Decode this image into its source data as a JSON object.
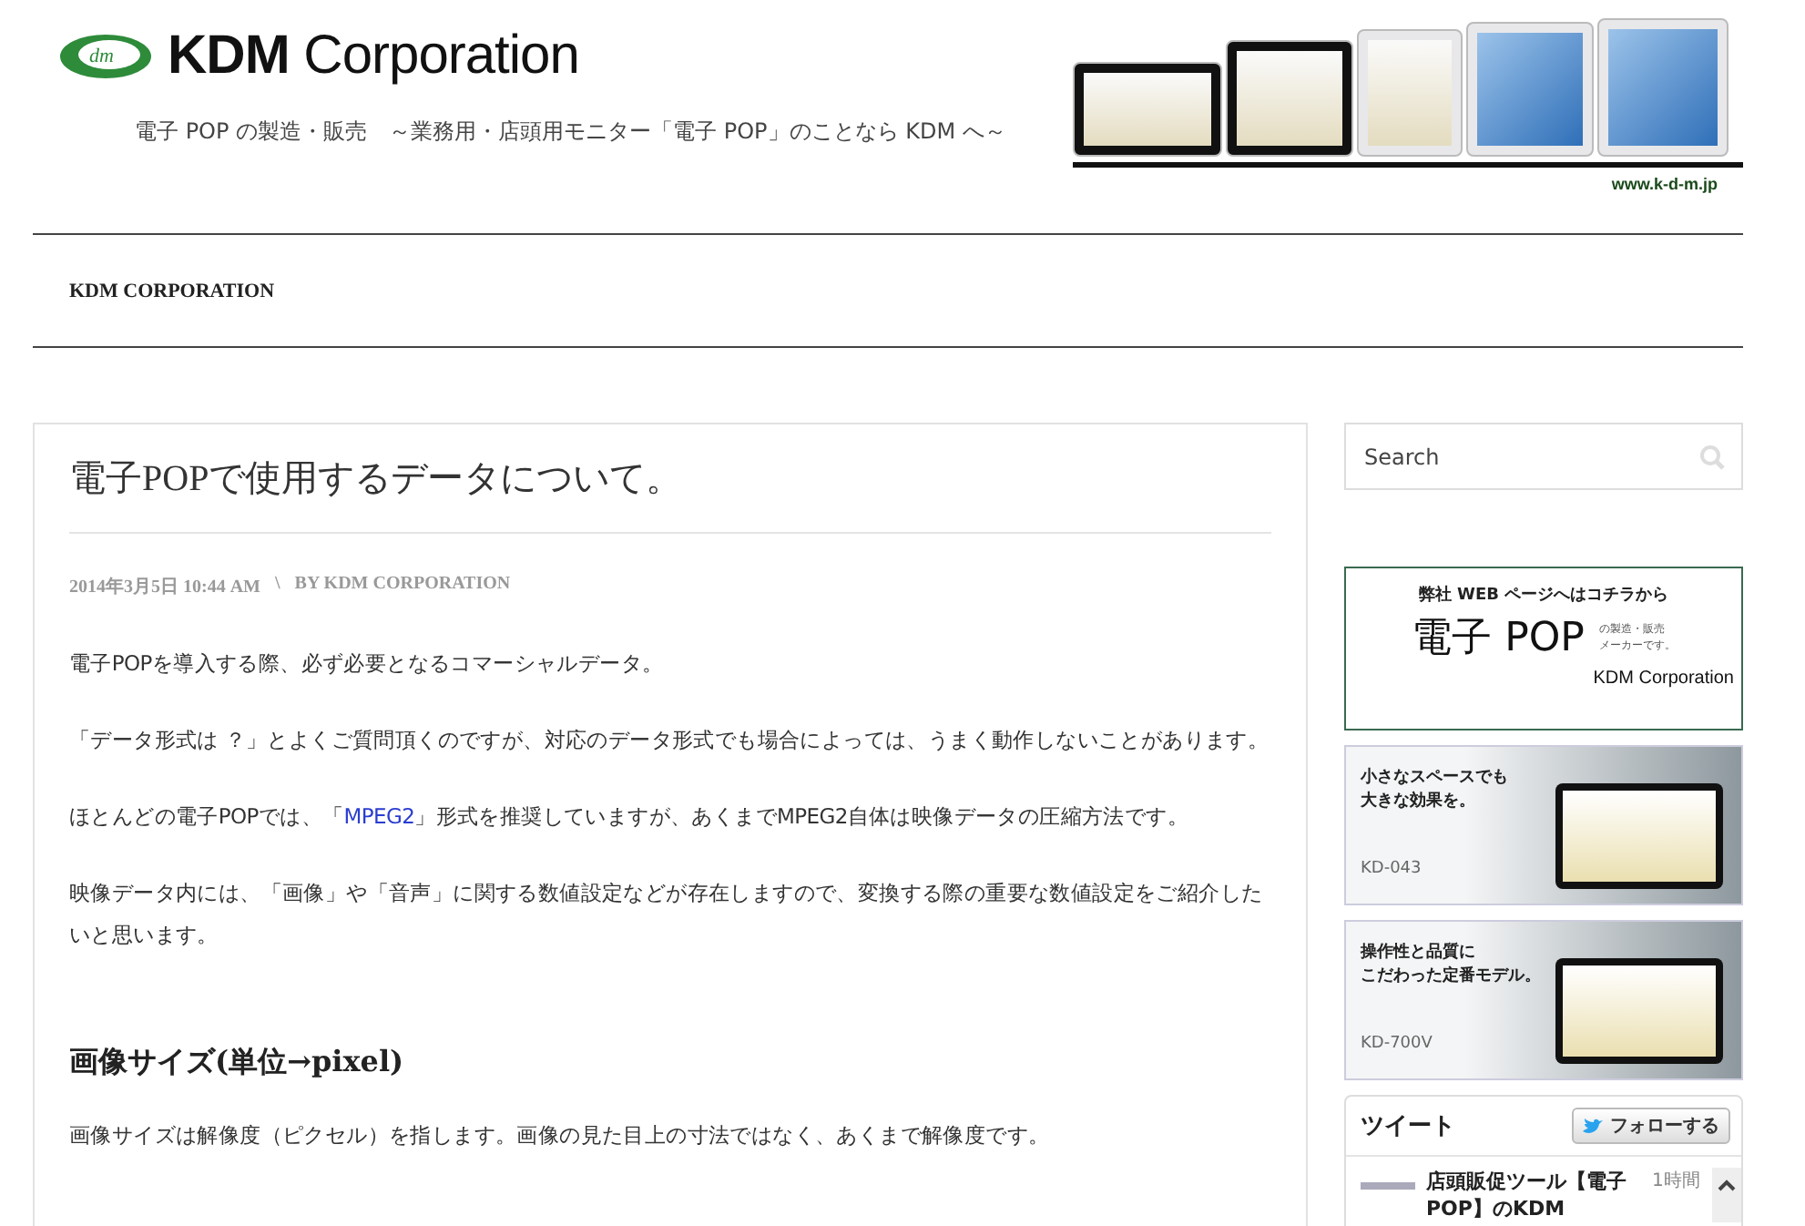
{
  "header": {
    "logo_mark": "dm",
    "brand": "KDM Corporation",
    "tagline": "電子 POP の製造・販売　～業務用・店頭用モニター「電子 POP」のことなら KDM へ～",
    "url": "www.k-d-m.jp"
  },
  "nav": {
    "items": [
      {
        "label": "KDM CORPORATION"
      }
    ]
  },
  "article": {
    "title": "電子POPで使用するデータについて。",
    "date": "2014年3月5日 10:44 AM",
    "separator": "\\",
    "byline": "BY KDM CORPORATION",
    "paragraphs": [
      {
        "kind": "text",
        "text": "電子POPを導入する際、必ず必要となるコマーシャルデータ。"
      },
      {
        "kind": "text",
        "text": "「データ形式は ？」とよくご質問頂くのですが、対応のデータ形式でも場合によっては、うまく動作しないことがあります。"
      },
      {
        "kind": "link",
        "before": "ほとんどの電子POPでは、「",
        "link": "MPEG2",
        "after": "」形式を推奨していますが、あくまでMPEG2自体は映像データの圧縮方法です。"
      },
      {
        "kind": "text",
        "text": "映像データ内には、「画像」や「音声」に関する数値設定などが存在しますので、変換する際の重要な数値設定をご紹介したいと思います。"
      },
      {
        "kind": "heading",
        "text": "画像サイズ(単位→pixel)"
      },
      {
        "kind": "text",
        "text": "画像サイズは解像度（ピクセル）を指します。画像の見た目上の寸法ではなく、あくまで解像度です。"
      }
    ]
  },
  "sidebar": {
    "search": {
      "placeholder": "Search"
    },
    "banners": [
      {
        "kind": "company",
        "line1": "弊社 WEB ページへはコチラから",
        "big": "電子 POP",
        "side1": "の製造・販売",
        "side2": "メーカーです。",
        "brand": "KDM Corporation"
      },
      {
        "kind": "product",
        "line1": "小さなスペースでも",
        "line2": "大きな効果を。",
        "model": "KD-043"
      },
      {
        "kind": "product",
        "line1": "操作性と品質に",
        "line2": "こだわった定番モデル。",
        "model": "KD-700V"
      }
    ],
    "twitter": {
      "title": "ツイート",
      "follow": "フォローする",
      "tweet": "店頭販促ツール【電子POP】のKDM",
      "time": "1時間"
    }
  }
}
